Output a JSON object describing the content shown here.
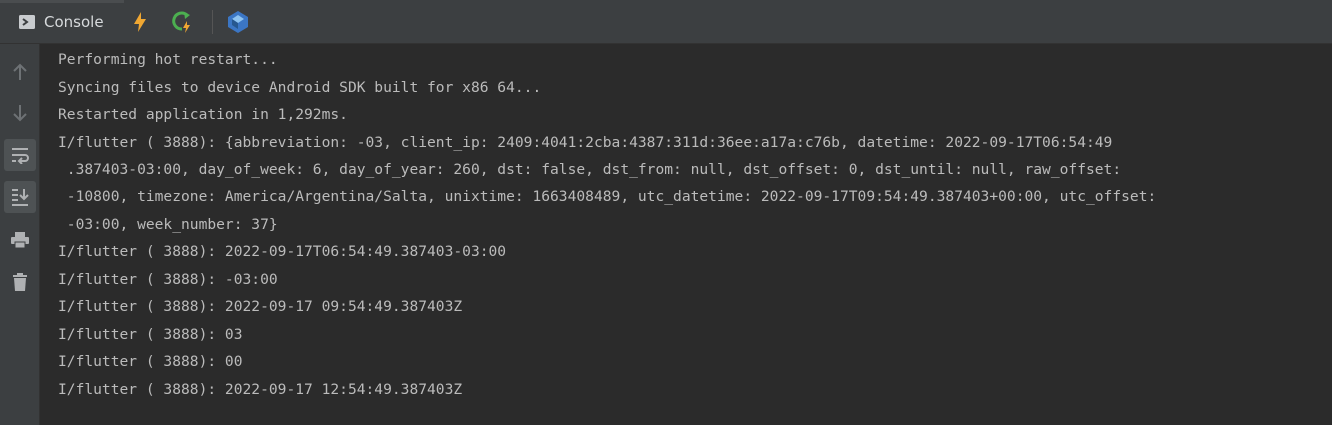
{
  "toolbar": {
    "console_tab_label": "Console",
    "icons": {
      "console": "terminal-icon",
      "hot_reload": "lightning-bolt-icon",
      "hot_restart": "hot-restart-icon",
      "dart_devtools": "dart-devtools-icon"
    }
  },
  "sidebar": {
    "items": [
      {
        "icon": "arrow-up-icon",
        "active": false
      },
      {
        "icon": "arrow-down-icon",
        "active": false
      },
      {
        "icon": "soft-wrap-icon",
        "active": true
      },
      {
        "icon": "scroll-to-end-icon",
        "active": true
      },
      {
        "icon": "print-icon",
        "active": false
      },
      {
        "icon": "trash-icon",
        "active": false
      }
    ]
  },
  "console": {
    "lines": [
      "Performing hot restart...",
      "Syncing files to device Android SDK built for x86 64...",
      "Restarted application in 1,292ms.",
      "I/flutter ( 3888): {abbreviation: -03, client_ip: 2409:4041:2cba:4387:311d:36ee:a17a:c76b, datetime: 2022-09-17T06:54:49",
      " .387403-03:00, day_of_week: 6, day_of_year: 260, dst: false, dst_from: null, dst_offset: 0, dst_until: null, raw_offset:",
      " -10800, timezone: America/Argentina/Salta, unixtime: 1663408489, utc_datetime: 2022-09-17T09:54:49.387403+00:00, utc_offset:",
      " -03:00, week_number: 37}",
      "I/flutter ( 3888): 2022-09-17T06:54:49.387403-03:00",
      "I/flutter ( 3888): -03:00",
      "I/flutter ( 3888): 2022-09-17 09:54:49.387403Z",
      "I/flutter ( 3888): 03",
      "I/flutter ( 3888): 00",
      "I/flutter ( 3888): 2022-09-17 12:54:49.387403Z"
    ]
  },
  "colors": {
    "background": "#2b2b2b",
    "panel": "#3c3f41",
    "text": "#bbbbbb",
    "hot_reload": "#f0a732",
    "hot_restart": "#4caf50",
    "dart": "#3b76c4"
  }
}
